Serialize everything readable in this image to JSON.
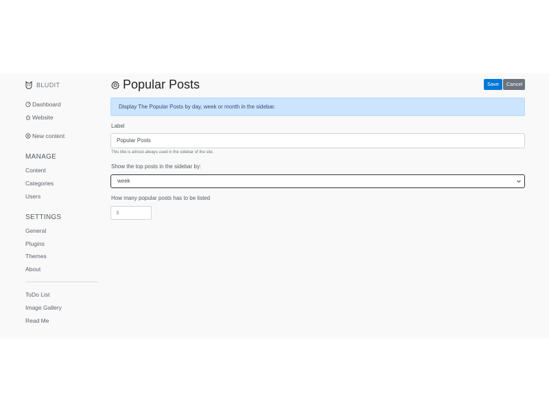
{
  "brand": {
    "name": "BLUDIT"
  },
  "sidebar": {
    "dashboard": "Dashboard",
    "website": "Website",
    "new_content": "New content",
    "manage_title": "MANAGE",
    "manage_items": [
      "Content",
      "Categories",
      "Users"
    ],
    "settings_title": "SETTINGS",
    "settings_items": [
      "General",
      "Plugins",
      "Themes",
      "About"
    ],
    "plugin_items": [
      "ToDo List",
      "Image Gallery",
      "Read Me"
    ]
  },
  "header": {
    "title": "Popular Posts",
    "save_label": "Save",
    "cancel_label": "Cancel"
  },
  "alert": {
    "text": "Display The Popular Posts by day, week or month in the sidebar."
  },
  "form": {
    "label_title": "Label",
    "label_value": "Popular Posts",
    "label_help": "This title is almost always used in the sidebar of the site.",
    "period_label": "Show the top posts in the sidebar by:",
    "period_value": "week",
    "count_label": "How many popular posts has to be listed",
    "count_value": "3"
  },
  "colors": {
    "accent": "#0078d7",
    "secondary": "#6c757d",
    "alert_bg": "#cce5ff",
    "page_bg": "#f9f9f9"
  },
  "icons": {
    "brand": "bludit-logo-icon",
    "dashboard": "speedometer-icon",
    "website": "home-icon",
    "new_content": "plus-circle-icon",
    "title": "gear-icon",
    "select": "chevron-down-icon"
  }
}
